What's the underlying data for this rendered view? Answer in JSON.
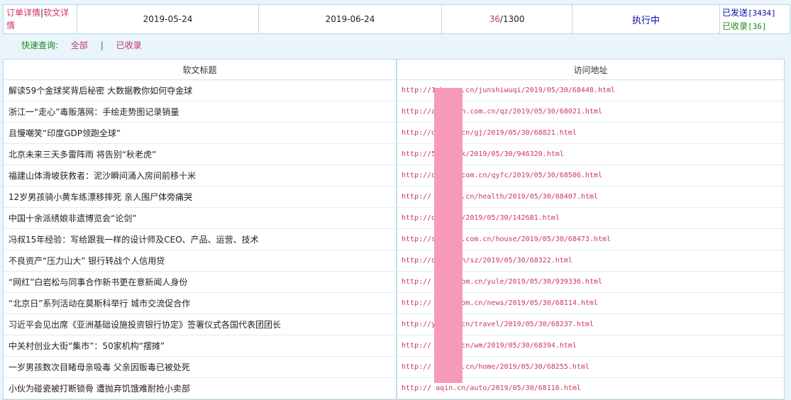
{
  "top": {
    "link_order_detail": "订单详情",
    "separator": "|",
    "link_article_detail": "软文详情",
    "start_date": "2019-05-24",
    "end_date": "2019-06-24",
    "count_done": "36",
    "count_total": "/1300",
    "status": "执行中",
    "sent_label": "已发送",
    "sent_count": "[3434]",
    "received_label": "已收录",
    "received_count": "[36]"
  },
  "quick_filter": {
    "label": "快速查询:",
    "all": "全部",
    "bar": "|",
    "received": "已收录"
  },
  "table": {
    "headers": [
      "软文标题",
      "访问地址"
    ],
    "rows": [
      {
        "title": "解读59个金球奖背后秘密 大数据教你如何夺金球",
        "url": "http://1        hengq.cn/junshiwuqi/2019/05/30/68448.html"
      },
      {
        "title": "浙江一“走心”毒贩落网：手绘走势图记录销量",
        "url": "http://a        heiyan.com.cn/qz/2019/05/30/68021.html"
      },
      {
        "title": "且慢嘲笑“印度GDP领跑全球”",
        "url": "http://d        .com.cn/gj/2019/05/30/68821.html"
      },
      {
        "title": "北京未来三天多雷阵雨 将告别“秋老虎”",
        "url": "http://5        n/zhbk/2019/05/30/946320.html"
      },
      {
        "title": "福建山体滑坡获救者：泥沙瞬间涌入房间前移十米",
        "url": "http://d        kai9.com.cn/qyfc/2019/05/30/68506.html"
      },
      {
        "title": "12岁男孩骑小黄车练漂移摔死 亲人围尸体旁痛哭",
        "url": "http://        ngjian.cn/health/2019/05/30/68407.html"
      },
      {
        "title": "中国十余派绣娘非遗博览会“论剑”",
        "url": "http://d        n/car/2019/05/30/142681.html"
      },
      {
        "title": "冯叔15年经验：写给跟我一样的设计师及CEO、产品、运营、技术",
        "url": "http://s        angke.com.cn/house/2019/05/30/68473.html"
      },
      {
        "title": "不良资产“压力山大” 银行转战个人信用贷",
        "url": "http://d        lin.cn/sz/2019/05/30/68322.html"
      },
      {
        "title": "“网红”白岩松与同事合作新书更在意新闻人身份",
        "url": "http://        hua3.com.cn/yule/2019/05/30/939336.html"
      },
      {
        "title": "“北京日”系列活动在莫斯科举行 城市交流促合作",
        "url": "http://        diao.com.cn/news/2019/05/30/68114.html"
      },
      {
        "title": "习近平会见出席《亚洲基础设施投资银行协定》签署仪式各国代表团团长",
        "url": "http://y        chun.cn/travel/2019/05/30/68237.html"
      },
      {
        "title": "中关村创业大街“集市”：50家机构“摆摊”",
        "url": "http://        g.com.cn/wm/2019/05/30/68394.html"
      },
      {
        "title": "一岁男孩数次目睹母亲吸毒 父亲因贩毒已被处死",
        "url": "http://        eihong.cn/home/2019/05/30/68255.html"
      },
      {
        "title": "小伙为碰瓷被打断锁骨 遭抛弃饥饿难耐抢小卖部",
        "url": "http://        aqin.cn/auto/2019/05/30/68116.html"
      }
    ]
  }
}
